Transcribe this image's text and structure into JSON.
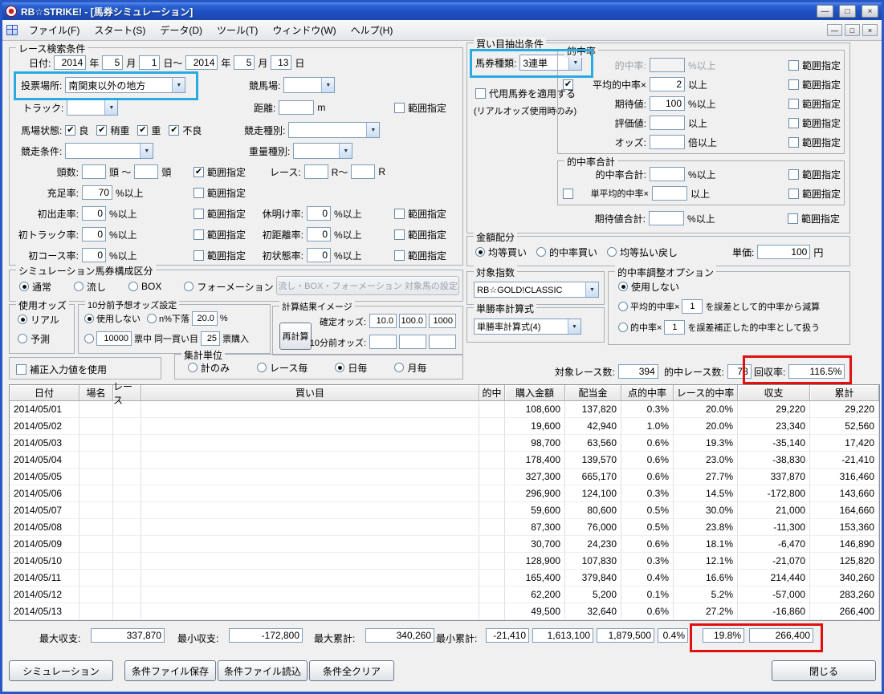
{
  "window": {
    "title": "RB☆STRIKE! - [馬券シミュレーション]"
  },
  "menubar": {
    "items": [
      "ファイル(F)",
      "スタート(S)",
      "データ(D)",
      "ツール(T)",
      "ウィンドウ(W)",
      "ヘルプ(H)"
    ]
  },
  "race_search": {
    "title": "レース検索条件",
    "date_label": "日付:",
    "from_year": "2014",
    "from_month": "5",
    "from_day": "1",
    "to_year": "2014",
    "to_month": "5",
    "to_day": "13",
    "u_year": "年",
    "u_month": "月",
    "u_day_tilde": "日～",
    "u_day": "日",
    "venue_label": "投票場所:",
    "venue_value": "南関東以外の地方",
    "keibajo_label": "競馬場:",
    "keibajo_value": "",
    "track_label": "トラック:",
    "track_value": "",
    "distance_label": "距離:",
    "distance_value": "",
    "distance_unit": "m",
    "range_label": "範囲指定",
    "baba_label": "馬場状態:",
    "baba1": "良",
    "baba2": "稍重",
    "baba3": "重",
    "baba4": "不良",
    "racetype_label": "競走種別:",
    "racetype_value": "",
    "racecond_label": "競走条件:",
    "racecond_value": "",
    "weight_label": "重量種別:",
    "weight_value": "",
    "heads_label": "頭数:",
    "heads_from": "",
    "heads_mid": "頭 ～",
    "heads_to": "",
    "heads_unit": "頭",
    "raceno_label": "レース:",
    "raceno_from": "",
    "raceno_mid": "R～",
    "raceno_to": "",
    "raceno_unit": "R",
    "fill_label": "充足率:",
    "fill_value": "70",
    "pct": "%以上",
    "r1a_label": "初出走率:",
    "r1a_value": "0",
    "r1b_label": "休明け率:",
    "r1b_value": "0",
    "r2a_label": "初トラック率:",
    "r2a_value": "0",
    "r2b_label": "初距離率:",
    "r2b_value": "0",
    "r3a_label": "初コース率:",
    "r3a_value": "0",
    "r3b_label": "初状態率:",
    "r3b_value": "0"
  },
  "kaime": {
    "title": "買い目抽出条件",
    "ticket_label": "馬券種類:",
    "ticket_value": "3連単",
    "daiyo_label": "代用馬券を適用する",
    "daiyo_note": "(リアルオッズ使用時のみ)",
    "hitrate_title": "的中率",
    "hitrate_label": "的中率:",
    "hitrate_value": "",
    "avg_label": "平均的中率×",
    "avg_value": "2",
    "ijou": "以上",
    "expect_label": "期待値:",
    "expect_value": "100",
    "eval_label": "評価値:",
    "eval_value": "",
    "odds_label": "オッズ:",
    "odds_value": "",
    "odds_unit": "倍以上",
    "total_title": "的中率合計",
    "total_label": "的中率合計:",
    "total_value": "",
    "tanavg_label": "単平均的中率×",
    "tanavg_value": "",
    "expect_total_label": "期待値合計:",
    "expect_total_value": "",
    "pct": "%以上",
    "range_label": "範囲指定"
  },
  "amount": {
    "title": "金額配分",
    "opt1": "均等買い",
    "opt2": "的中率買い",
    "opt3": "均等払い戻し",
    "unit_label": "単価:",
    "unit_value": "100",
    "unit_suffix": "円"
  },
  "composition": {
    "title": "シミュレーション馬券構成区分",
    "opt1": "通常",
    "opt2": "流し",
    "opt3": "BOX",
    "opt4": "フォーメーション",
    "config_button": "流し・BOX・フォーメーション 対象馬の設定"
  },
  "odds_used": {
    "title": "使用オッズ",
    "opt1": "リアル",
    "opt2": "予測"
  },
  "pre10": {
    "title": "10分前予想オッズ設定",
    "opt_none": "使用しない",
    "opt_drop": "n%下落",
    "drop_value": "20.0",
    "drop_unit": "%",
    "votes_value": "10000",
    "votes_label": "票中 同一買い目",
    "buy_value": "25",
    "buy_label": "票購入"
  },
  "calc": {
    "title": "計算結果イメージ",
    "recalc_button": "再計算",
    "fixed_label": "確定オッズ:",
    "fixed1": "10.0",
    "fixed2": "100.0",
    "fixed3": "1000",
    "pre_label": "10分前オッズ:",
    "pre1": "",
    "pre2": "",
    "pre3": ""
  },
  "target_index": {
    "title": "対象指数",
    "value": "RB☆GOLD!CLASSIC"
  },
  "win_formula": {
    "title": "単勝率計算式",
    "value": "単勝率計算式(4)"
  },
  "adjust": {
    "title": "的中率調整オプション",
    "opt_none": "使用しない",
    "opt2_pre": "平均的中率×",
    "opt2_value": "1",
    "opt2_post": "を誤差として的中率から減算",
    "opt3_pre": "的中率×",
    "opt3_value": "1",
    "opt3_post": "を誤差補正した的中率として扱う"
  },
  "correction": {
    "label": "補正入力値を使用"
  },
  "aggregate": {
    "title": "集計単位",
    "opt1": "計のみ",
    "opt2": "レース毎",
    "opt3": "日毎",
    "opt4": "月毎"
  },
  "stats": {
    "target_label": "対象レース数:",
    "target_value": "394",
    "hit_label": "的中レース数:",
    "hit_value": "78",
    "recovery_label": "回収率:",
    "recovery_value": "116.5%"
  },
  "table": {
    "headers": [
      "日付",
      "場名",
      "レース",
      "買い目",
      "的中",
      "購入金額",
      "配当金",
      "点的中率",
      "レース的中率",
      "収支",
      "累計"
    ],
    "rows": [
      {
        "date": "2014/05/01",
        "purchase": "108,600",
        "payout": "137,820",
        "point": "0.3%",
        "race": "20.0%",
        "balance": "29,220",
        "total": "29,220"
      },
      {
        "date": "2014/05/02",
        "purchase": "19,600",
        "payout": "42,940",
        "point": "1.0%",
        "race": "20.0%",
        "balance": "23,340",
        "total": "52,560"
      },
      {
        "date": "2014/05/03",
        "purchase": "98,700",
        "payout": "63,560",
        "point": "0.6%",
        "race": "19.3%",
        "balance": "-35,140",
        "total": "17,420"
      },
      {
        "date": "2014/05/04",
        "purchase": "178,400",
        "payout": "139,570",
        "point": "0.6%",
        "race": "23.0%",
        "balance": "-38,830",
        "total": "-21,410"
      },
      {
        "date": "2014/05/05",
        "purchase": "327,300",
        "payout": "665,170",
        "point": "0.6%",
        "race": "27.7%",
        "balance": "337,870",
        "total": "316,460"
      },
      {
        "date": "2014/05/06",
        "purchase": "296,900",
        "payout": "124,100",
        "point": "0.3%",
        "race": "14.5%",
        "balance": "-172,800",
        "total": "143,660"
      },
      {
        "date": "2014/05/07",
        "purchase": "59,600",
        "payout": "80,600",
        "point": "0.5%",
        "race": "30.0%",
        "balance": "21,000",
        "total": "164,660"
      },
      {
        "date": "2014/05/08",
        "purchase": "87,300",
        "payout": "76,000",
        "point": "0.5%",
        "race": "23.8%",
        "balance": "-11,300",
        "total": "153,360"
      },
      {
        "date": "2014/05/09",
        "purchase": "30,700",
        "payout": "24,230",
        "point": "0.6%",
        "race": "18.1%",
        "balance": "-6,470",
        "total": "146,890"
      },
      {
        "date": "2014/05/10",
        "purchase": "128,900",
        "payout": "107,830",
        "point": "0.3%",
        "race": "12.1%",
        "balance": "-21,070",
        "total": "125,820"
      },
      {
        "date": "2014/05/11",
        "purchase": "165,400",
        "payout": "379,840",
        "point": "0.4%",
        "race": "16.6%",
        "balance": "214,440",
        "total": "340,260"
      },
      {
        "date": "2014/05/12",
        "purchase": "62,200",
        "payout": "5,200",
        "point": "0.1%",
        "race": "5.2%",
        "balance": "-57,000",
        "total": "283,260"
      },
      {
        "date": "2014/05/13",
        "purchase": "49,500",
        "payout": "32,640",
        "point": "0.6%",
        "race": "27.2%",
        "balance": "-16,860",
        "total": "266,400"
      }
    ]
  },
  "summary": {
    "max_balance_label": "最大収支:",
    "max_balance": "337,870",
    "min_balance_label": "最小収支:",
    "min_balance": "-172,800",
    "max_total_label": "最大累計:",
    "max_total": "340,260",
    "min_total_label": "最小累計:",
    "min_total": "-21,410",
    "purchase_total": "1,613,100",
    "payout_total": "1,879,500",
    "point_rate": "0.4%",
    "race_rate": "19.8%",
    "balance_total": "266,400"
  },
  "buttons": {
    "simulate": "シミュレーション",
    "save": "条件ファイル保存",
    "load": "条件ファイル読込",
    "clear": "条件全クリア",
    "close": "閉じる"
  },
  "annotations": {
    "blue": "#29abe2",
    "red": "#e01010"
  },
  "states": {
    "baba1": true,
    "baba2": true,
    "baba3": true,
    "baba4": true,
    "distance_range": false,
    "heads_range": true,
    "fill_range": false,
    "r1a_range": false,
    "r1b_range": false,
    "r2a_range": false,
    "r2b_range": false,
    "r3a_range": false,
    "r3b_range": false,
    "daiyo": false,
    "hitrate_range": false,
    "avg_check": true,
    "avg_range": false,
    "expect_range": false,
    "eval_range": false,
    "odds_range": false,
    "total_range": false,
    "tanavg_check": false,
    "tanavg_range": false,
    "expect_total_range": false,
    "amount1": true,
    "amount2": false,
    "amount3": false,
    "comp1": true,
    "comp2": false,
    "comp3": false,
    "comp4": false,
    "odds1": true,
    "odds2": false,
    "pre_none": true,
    "pre_drop": false,
    "pre_votes": false,
    "adjust1": true,
    "adjust2": false,
    "adjust3": false,
    "correction": false,
    "agg1": false,
    "agg2": false,
    "agg3": true,
    "agg4": false
  }
}
